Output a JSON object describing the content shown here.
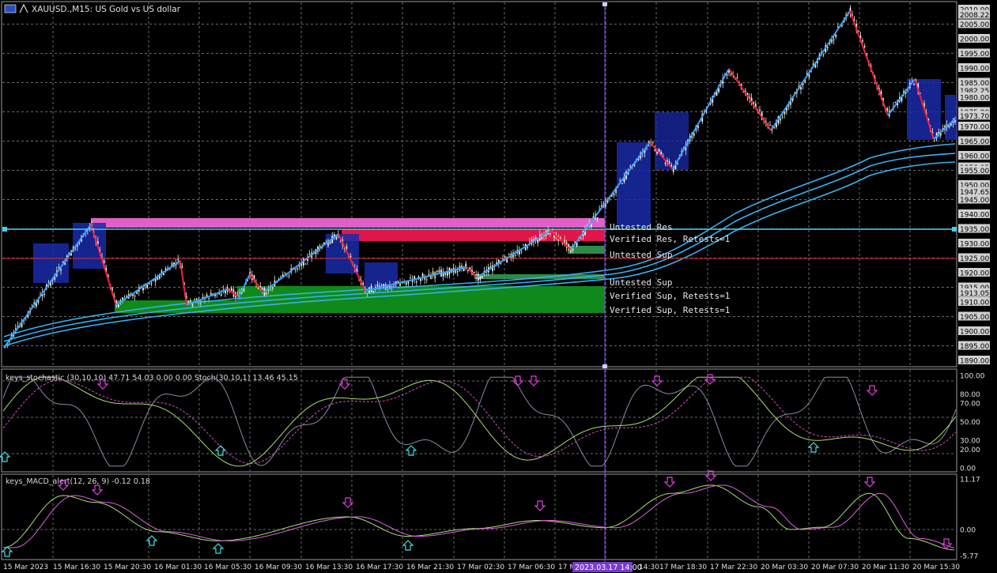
{
  "window": {
    "symbol_title": "XAUUSD.,M15:  US Gold vs US dollar"
  },
  "main_chart": {
    "price_labels": [
      "2010.00",
      "2008.22",
      "2005.00",
      "2000.00",
      "1995.00",
      "1990.00",
      "1985.00",
      "1982.25",
      "1980.00",
      "1975.00",
      "1973.70",
      "1970.00",
      "1965.00",
      "1960.00",
      "1956.05",
      "1955.00",
      "1950.00",
      "1947.65",
      "1945.00",
      "1940.00",
      "1935.00",
      "1930.00",
      "1925.00",
      "1920.00",
      "1915.00",
      "1913.05",
      "1910.00",
      "1905.00",
      "1900.00",
      "1895.00",
      "1890.00"
    ],
    "zone_labels": [
      "Untested Res",
      "Verified Res, Retests=1",
      "Untested Sup",
      "Untested Sup",
      "Verified Sup, Retests=1",
      "Verified Sup, Retests=1"
    ],
    "colors": {
      "up_zigzag": "#3aa0ff",
      "down_zigzag": "#ff1e3c",
      "resistance_zone": "#e0168a",
      "resistance_zone_2": "#ff2050",
      "support_zone": "#0f8a1a",
      "box": "#1a2aa8",
      "ma": "#3ab0f0",
      "crosshair": "#7a3ad0"
    }
  },
  "stochastic": {
    "title": "keys_stochastic (30,10,10) 47.71 54.03 0.00 0.00 Stoch(30,10,1) 13.46 45.15",
    "levels": [
      "100.00",
      "80.00",
      "70.00",
      "50.00",
      "30.00",
      "20.00",
      "0.00"
    ]
  },
  "macd": {
    "title": "keys_MACD_alert(12, 26, 9) -0.12 0.18",
    "levels": [
      "11.17",
      "0.00",
      "-5.77"
    ]
  },
  "time_axis": {
    "labels": [
      "15 Mar 2023",
      "15 Mar 16:30",
      "15 Mar 20:30",
      "16 Mar 01:30",
      "16 Mar 05:30",
      "16 Mar 09:30",
      "16 Mar 13:30",
      "16 Mar 17:30",
      "16 Mar 21:30",
      "17 Mar 02:30",
      "17 Mar 06:30",
      "17 M",
      "14:30",
      "17 Mar 18:30",
      "17 Mar 22:30",
      "20 Mar 03:30",
      "20 Mar 07:30",
      "20 Mar 11:30",
      "20 Mar 15:30"
    ],
    "crosshair_label": "2023.03.17 14:00"
  }
}
